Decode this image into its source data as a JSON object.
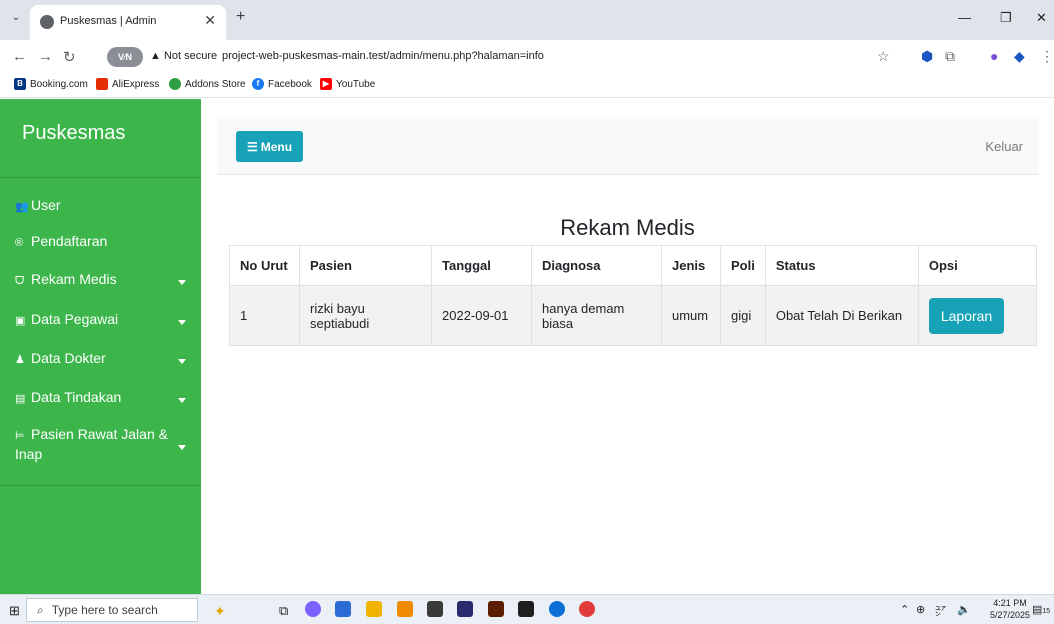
{
  "browser": {
    "tab_title": "Puskesmas | Admin",
    "not_secure": "Not secure",
    "url": "project-web-puskesmas-main.test/admin/menu.php?halaman=info",
    "vpn": "V⁄N",
    "bookmarks": [
      {
        "label": "Booking.com",
        "icon": "booking-icon",
        "color": "#003580"
      },
      {
        "label": "AliExpress",
        "icon": "aliexpress-icon",
        "color": "#e62e04"
      },
      {
        "label": "Addons Store",
        "icon": "addons-icon",
        "color": "#2f9e44"
      },
      {
        "label": "Facebook",
        "icon": "facebook-icon",
        "color": "#1877f2"
      },
      {
        "label": "YouTube",
        "icon": "youtube-icon",
        "color": "#ff0000"
      }
    ]
  },
  "sidebar": {
    "brand": "Puskesmas",
    "items": [
      {
        "label": "User",
        "icon": "users-icon"
      },
      {
        "label": "Pendaftaran",
        "icon": "registered-icon"
      },
      {
        "label": "Rekam Medis",
        "icon": "stethoscope-icon"
      },
      {
        "label": "Data Pegawai",
        "icon": "id-card-icon"
      },
      {
        "label": "Data Dokter",
        "icon": "doctor-icon"
      },
      {
        "label": "Data Tindakan",
        "icon": "clinic-icon"
      },
      {
        "label": "Pasien Rawat Jalan &",
        "label2": "Inap",
        "icon": "bed-icon"
      }
    ]
  },
  "topbar": {
    "menu_label": "Menu",
    "logout_label": "Keluar"
  },
  "main": {
    "title": "Rekam Medis",
    "columns": [
      "No Urut",
      "Pasien",
      "Tanggal",
      "Diagnosa",
      "Jenis",
      "Poli",
      "Status",
      "Opsi"
    ],
    "rows": [
      {
        "no": "1",
        "pasien": "rizki bayu septiabudi",
        "tanggal": "2022-09-01",
        "diagnosa": "hanya demam biasa",
        "jenis": "umum",
        "poli": "gigi",
        "status": "Obat Telah Di Berikan",
        "opsi": "Laporan"
      }
    ]
  },
  "taskbar": {
    "search_placeholder": "Type here to search",
    "time": "4:21 PM",
    "date": "5/27/2025",
    "notifications": "15"
  },
  "colors": {
    "sidebar": "#3cb64b",
    "accent": "#17a2b8"
  }
}
